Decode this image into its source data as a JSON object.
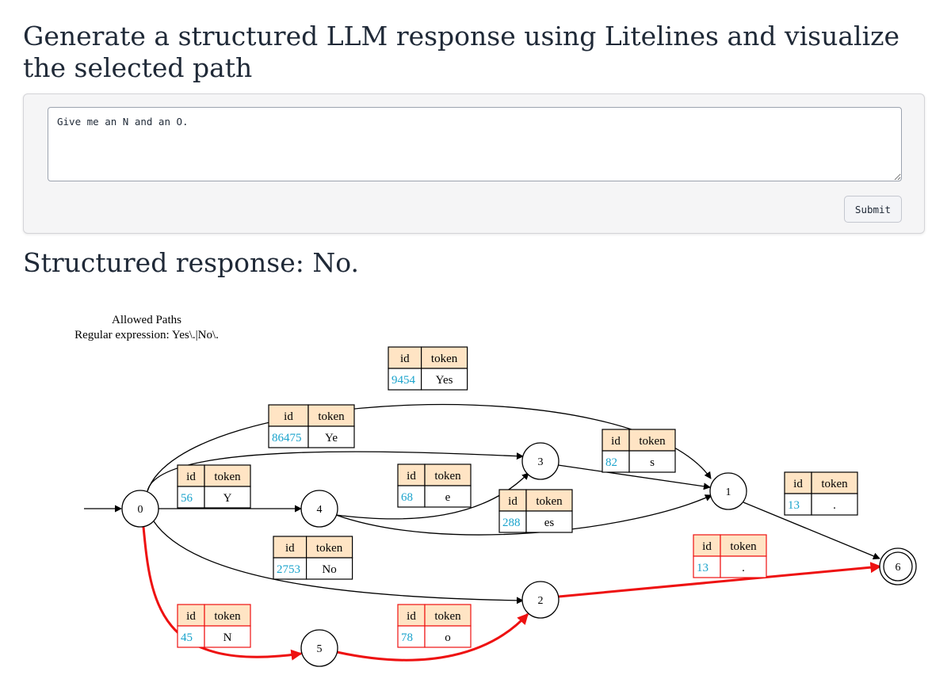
{
  "page": {
    "title": "Generate a structured LLM response using Litelines and visualize the selected path"
  },
  "form": {
    "prompt_value": "Give me an N and an O.",
    "submit_label": "Submit"
  },
  "response": {
    "heading": "Structured response: No."
  },
  "graph": {
    "title_line1": "Allowed Paths",
    "title_line2": "Regular expression: Yes\\.|No\\.",
    "colors": {
      "selected": "#ee1111",
      "id_text": "#1aa3cc",
      "header_fill": "#ffe4c4",
      "edge": "#000000"
    },
    "states": [
      "0",
      "1",
      "2",
      "3",
      "4",
      "5",
      "6"
    ],
    "start_state": "0",
    "final_state": "6",
    "edges": [
      {
        "from": "0",
        "to": "1",
        "id": "9454",
        "token": "Yes",
        "selected": false
      },
      {
        "from": "0",
        "to": "3",
        "id": "86475",
        "token": "Ye",
        "selected": false
      },
      {
        "from": "0",
        "to": "4",
        "id": "56",
        "token": "Y",
        "selected": false
      },
      {
        "from": "4",
        "to": "3",
        "id": "68",
        "token": "e",
        "selected": false
      },
      {
        "from": "3",
        "to": "1",
        "id": "82",
        "token": "s",
        "selected": false
      },
      {
        "from": "4",
        "to": "1",
        "id": "288",
        "token": "es",
        "selected": false
      },
      {
        "from": "1",
        "to": "6",
        "id": "13",
        "token": ".",
        "selected": false
      },
      {
        "from": "0",
        "to": "2",
        "id": "2753",
        "token": "No",
        "selected": false
      },
      {
        "from": "0",
        "to": "5",
        "id": "45",
        "token": "N",
        "selected": true
      },
      {
        "from": "5",
        "to": "2",
        "id": "78",
        "token": "o",
        "selected": true
      },
      {
        "from": "2",
        "to": "6",
        "id": "13",
        "token": ".",
        "selected": true
      }
    ],
    "table_header": {
      "id": "id",
      "token": "token"
    }
  }
}
